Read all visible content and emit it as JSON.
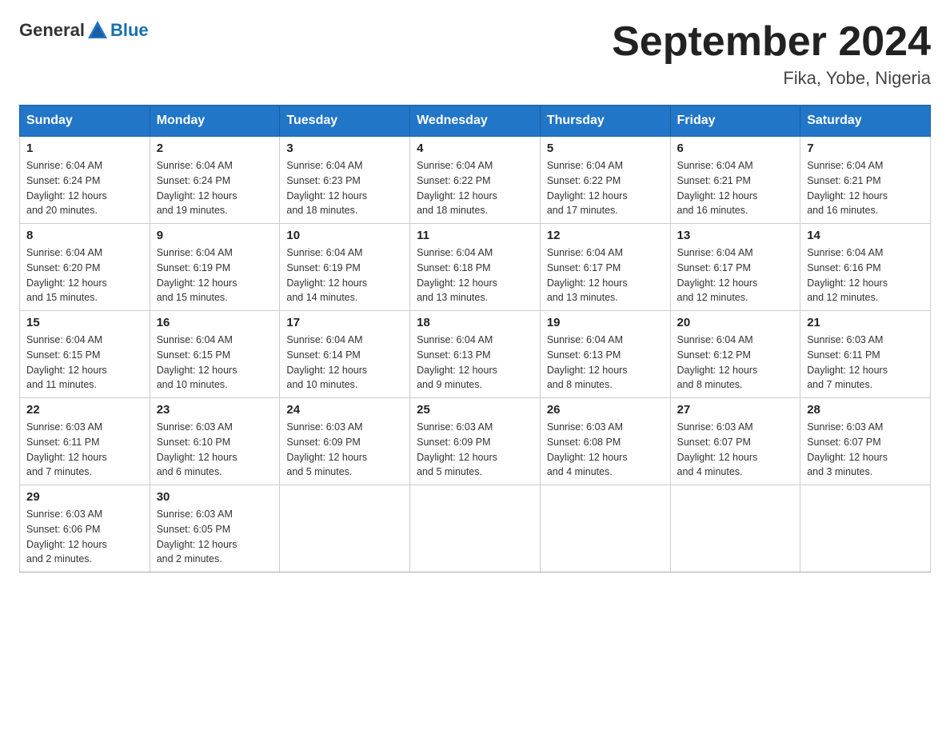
{
  "header": {
    "title": "September 2024",
    "location": "Fika, Yobe, Nigeria",
    "logo_general": "General",
    "logo_blue": "Blue"
  },
  "weekdays": [
    "Sunday",
    "Monday",
    "Tuesday",
    "Wednesday",
    "Thursday",
    "Friday",
    "Saturday"
  ],
  "weeks": [
    [
      {
        "day": "1",
        "sunrise": "6:04 AM",
        "sunset": "6:24 PM",
        "daylight": "12 hours and 20 minutes."
      },
      {
        "day": "2",
        "sunrise": "6:04 AM",
        "sunset": "6:24 PM",
        "daylight": "12 hours and 19 minutes."
      },
      {
        "day": "3",
        "sunrise": "6:04 AM",
        "sunset": "6:23 PM",
        "daylight": "12 hours and 18 minutes."
      },
      {
        "day": "4",
        "sunrise": "6:04 AM",
        "sunset": "6:22 PM",
        "daylight": "12 hours and 18 minutes."
      },
      {
        "day": "5",
        "sunrise": "6:04 AM",
        "sunset": "6:22 PM",
        "daylight": "12 hours and 17 minutes."
      },
      {
        "day": "6",
        "sunrise": "6:04 AM",
        "sunset": "6:21 PM",
        "daylight": "12 hours and 16 minutes."
      },
      {
        "day": "7",
        "sunrise": "6:04 AM",
        "sunset": "6:21 PM",
        "daylight": "12 hours and 16 minutes."
      }
    ],
    [
      {
        "day": "8",
        "sunrise": "6:04 AM",
        "sunset": "6:20 PM",
        "daylight": "12 hours and 15 minutes."
      },
      {
        "day": "9",
        "sunrise": "6:04 AM",
        "sunset": "6:19 PM",
        "daylight": "12 hours and 15 minutes."
      },
      {
        "day": "10",
        "sunrise": "6:04 AM",
        "sunset": "6:19 PM",
        "daylight": "12 hours and 14 minutes."
      },
      {
        "day": "11",
        "sunrise": "6:04 AM",
        "sunset": "6:18 PM",
        "daylight": "12 hours and 13 minutes."
      },
      {
        "day": "12",
        "sunrise": "6:04 AM",
        "sunset": "6:17 PM",
        "daylight": "12 hours and 13 minutes."
      },
      {
        "day": "13",
        "sunrise": "6:04 AM",
        "sunset": "6:17 PM",
        "daylight": "12 hours and 12 minutes."
      },
      {
        "day": "14",
        "sunrise": "6:04 AM",
        "sunset": "6:16 PM",
        "daylight": "12 hours and 12 minutes."
      }
    ],
    [
      {
        "day": "15",
        "sunrise": "6:04 AM",
        "sunset": "6:15 PM",
        "daylight": "12 hours and 11 minutes."
      },
      {
        "day": "16",
        "sunrise": "6:04 AM",
        "sunset": "6:15 PM",
        "daylight": "12 hours and 10 minutes."
      },
      {
        "day": "17",
        "sunrise": "6:04 AM",
        "sunset": "6:14 PM",
        "daylight": "12 hours and 10 minutes."
      },
      {
        "day": "18",
        "sunrise": "6:04 AM",
        "sunset": "6:13 PM",
        "daylight": "12 hours and 9 minutes."
      },
      {
        "day": "19",
        "sunrise": "6:04 AM",
        "sunset": "6:13 PM",
        "daylight": "12 hours and 8 minutes."
      },
      {
        "day": "20",
        "sunrise": "6:04 AM",
        "sunset": "6:12 PM",
        "daylight": "12 hours and 8 minutes."
      },
      {
        "day": "21",
        "sunrise": "6:03 AM",
        "sunset": "6:11 PM",
        "daylight": "12 hours and 7 minutes."
      }
    ],
    [
      {
        "day": "22",
        "sunrise": "6:03 AM",
        "sunset": "6:11 PM",
        "daylight": "12 hours and 7 minutes."
      },
      {
        "day": "23",
        "sunrise": "6:03 AM",
        "sunset": "6:10 PM",
        "daylight": "12 hours and 6 minutes."
      },
      {
        "day": "24",
        "sunrise": "6:03 AM",
        "sunset": "6:09 PM",
        "daylight": "12 hours and 5 minutes."
      },
      {
        "day": "25",
        "sunrise": "6:03 AM",
        "sunset": "6:09 PM",
        "daylight": "12 hours and 5 minutes."
      },
      {
        "day": "26",
        "sunrise": "6:03 AM",
        "sunset": "6:08 PM",
        "daylight": "12 hours and 4 minutes."
      },
      {
        "day": "27",
        "sunrise": "6:03 AM",
        "sunset": "6:07 PM",
        "daylight": "12 hours and 4 minutes."
      },
      {
        "day": "28",
        "sunrise": "6:03 AM",
        "sunset": "6:07 PM",
        "daylight": "12 hours and 3 minutes."
      }
    ],
    [
      {
        "day": "29",
        "sunrise": "6:03 AM",
        "sunset": "6:06 PM",
        "daylight": "12 hours and 2 minutes."
      },
      {
        "day": "30",
        "sunrise": "6:03 AM",
        "sunset": "6:05 PM",
        "daylight": "12 hours and 2 minutes."
      },
      null,
      null,
      null,
      null,
      null
    ]
  ],
  "labels": {
    "sunrise": "Sunrise:",
    "sunset": "Sunset:",
    "daylight": "Daylight:"
  }
}
